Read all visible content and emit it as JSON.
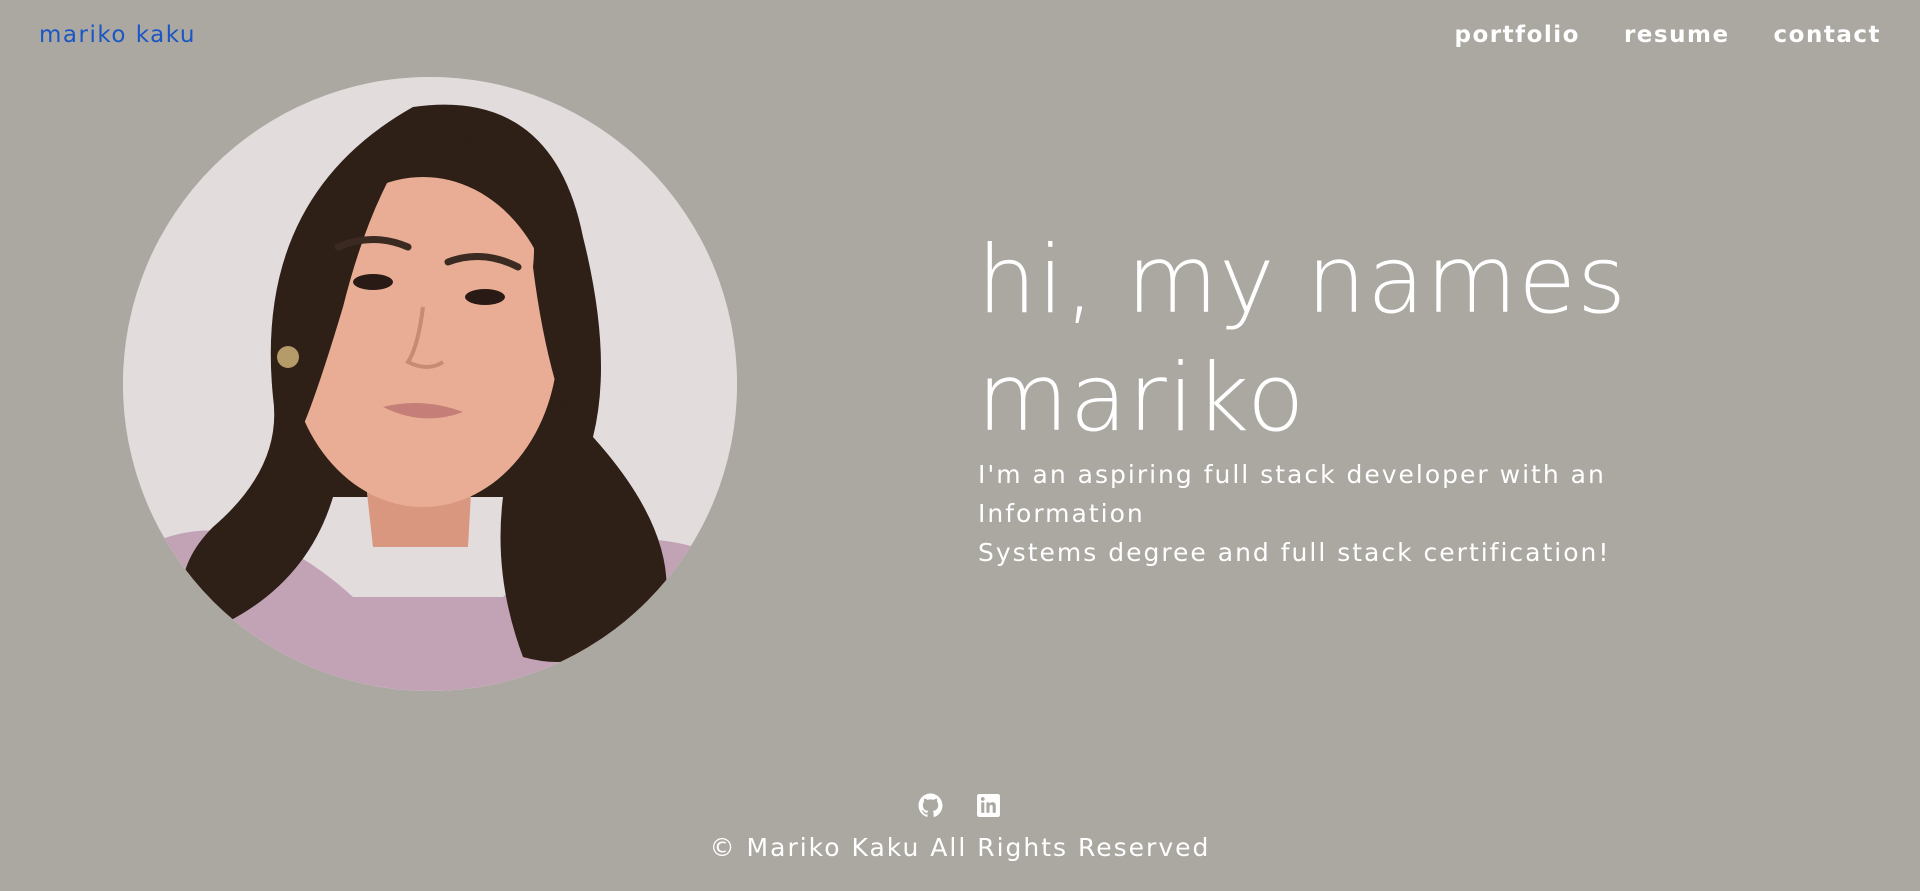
{
  "header": {
    "brand": "mariko kaku",
    "nav": [
      "portfolio",
      "resume",
      "contact"
    ]
  },
  "profile_photo": {
    "icon": "portrait-photo",
    "colors": {
      "background": "#e2dcdd",
      "hair": "#2e1f17",
      "skin": "#e8ad94",
      "sweater": "#c2a3b5"
    }
  },
  "hero": {
    "title_line1": "hi, my names",
    "title_line2": "mariko",
    "subtitle_line1": "I'm an aspiring full stack developer with an Information",
    "subtitle_line2": "Systems degree and full stack certification!"
  },
  "footer": {
    "social_icons": [
      "github-icon",
      "linkedin-icon"
    ],
    "copyright": "© Mariko Kaku All Rights Reserved"
  },
  "colors": {
    "page_background": "#aba7a1",
    "brand_link": "#1a56c4",
    "text": "#ffffff"
  }
}
